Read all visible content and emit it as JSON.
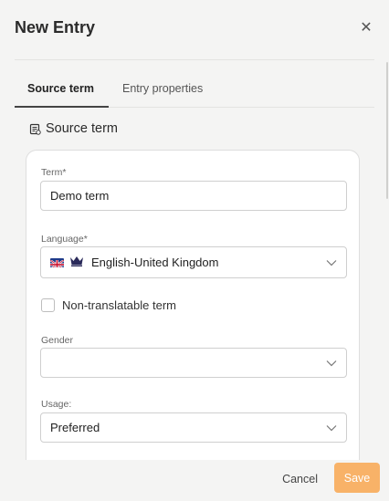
{
  "dialog": {
    "title": "New Entry"
  },
  "tabs": [
    {
      "label": "Source term",
      "active": true
    },
    {
      "label": "Entry properties",
      "active": false
    }
  ],
  "section": {
    "title": "Source term"
  },
  "form": {
    "term": {
      "label": "Term*",
      "value": "Demo term"
    },
    "language": {
      "label": "Language*",
      "value": "English-United Kingdom"
    },
    "non_translatable": {
      "label": "Non-translatable term",
      "checked": false
    },
    "gender": {
      "label": "Gender",
      "value": ""
    },
    "usage": {
      "label": "Usage:",
      "value": "Preferred"
    }
  },
  "footer": {
    "cancel_label": "Cancel",
    "save_label": "Save"
  },
  "colors": {
    "accent": "#f8b268",
    "background": "#f4f4f3",
    "card": "#ffffff"
  }
}
